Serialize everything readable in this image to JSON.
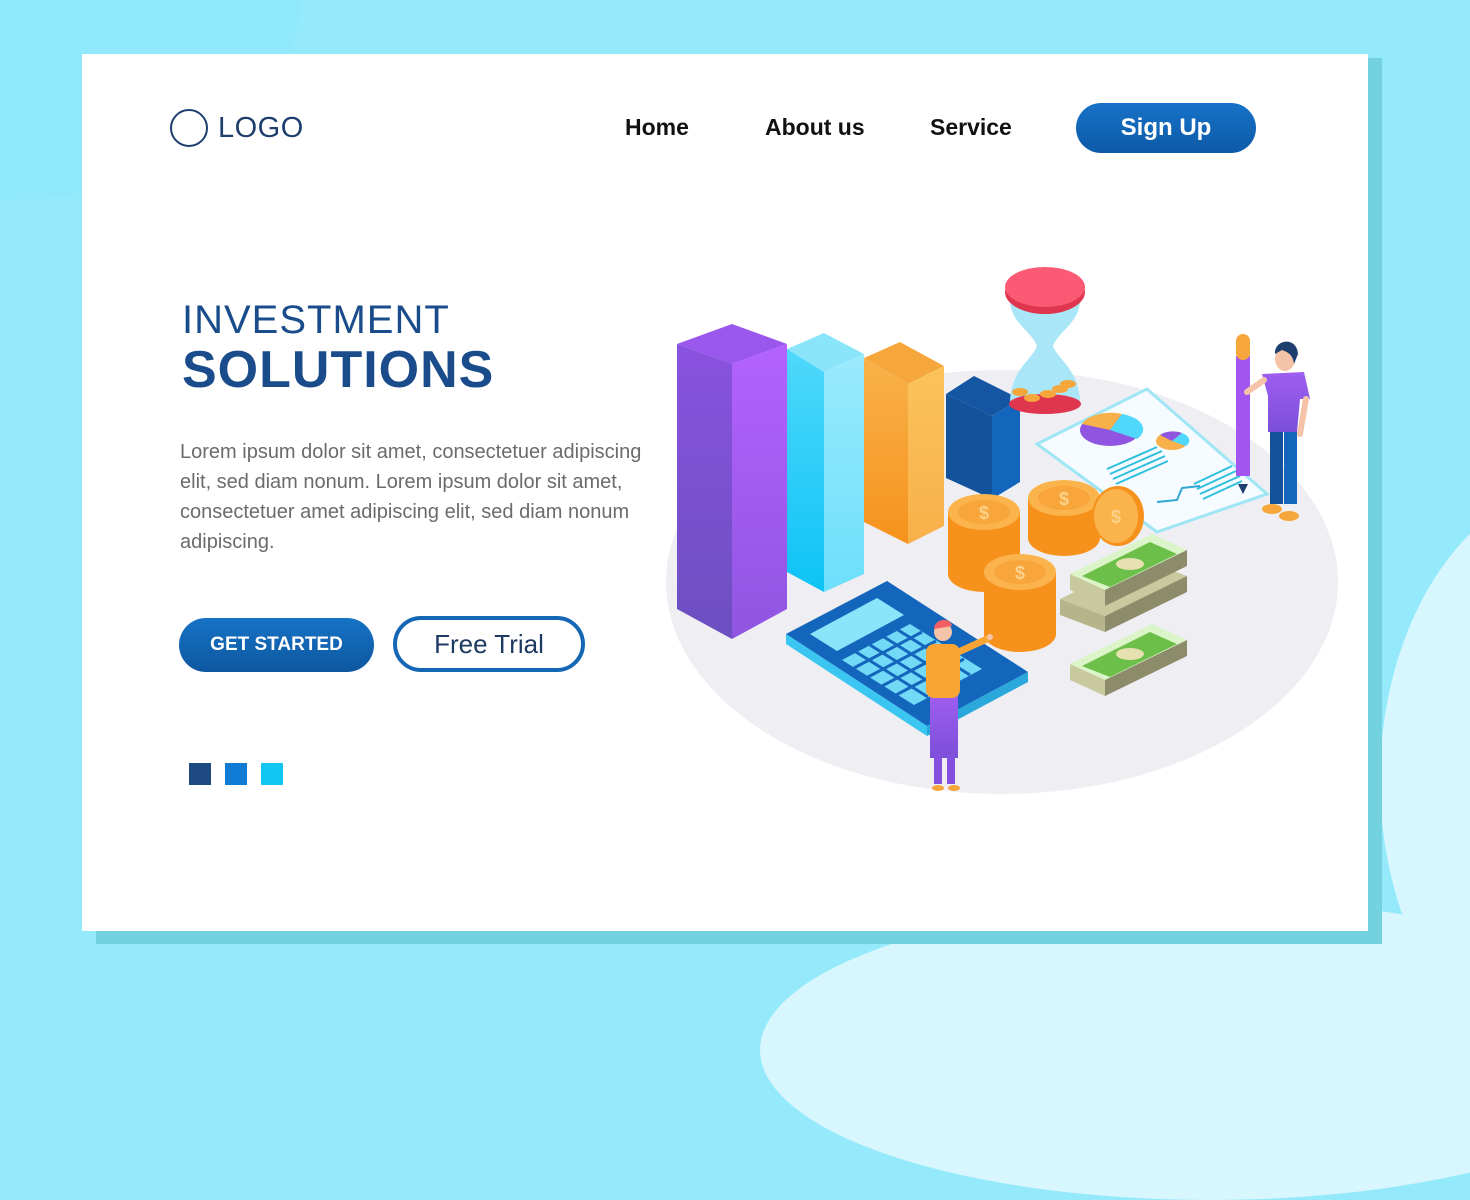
{
  "header": {
    "logo_text": "LOGO",
    "nav": [
      {
        "label": "Home"
      },
      {
        "label": "About us"
      },
      {
        "label": "Service"
      }
    ],
    "signup_label": "Sign Up"
  },
  "hero": {
    "title_line1": "INVESTMENT",
    "title_line2": "SOLUTIONS",
    "description": "Lorem ipsum dolor sit amet, consectetuer adipiscing elit, sed diam nonum. Lorem ipsum dolor sit amet, consectetuer amet adipiscing elit, sed diam nonum adipiscing.",
    "primary_button": "GET STARTED",
    "secondary_button": "Free Trial"
  },
  "pagination": {
    "dots": [
      {
        "color": "#1e4a82"
      },
      {
        "color": "#0f7bd4"
      },
      {
        "color": "#12c6f2"
      }
    ]
  },
  "illustration": {
    "description": "Isometric investment illustration: bar chart, hourglass with coins, report with pie charts, coin stacks, cash bundles, calculator, two people",
    "coin_symbol": "$"
  },
  "colors": {
    "brand_dark": "#1a4c8b",
    "brand_button": "#1566b5",
    "background": "#94e9fb",
    "card_shadow": "#74d1df"
  }
}
